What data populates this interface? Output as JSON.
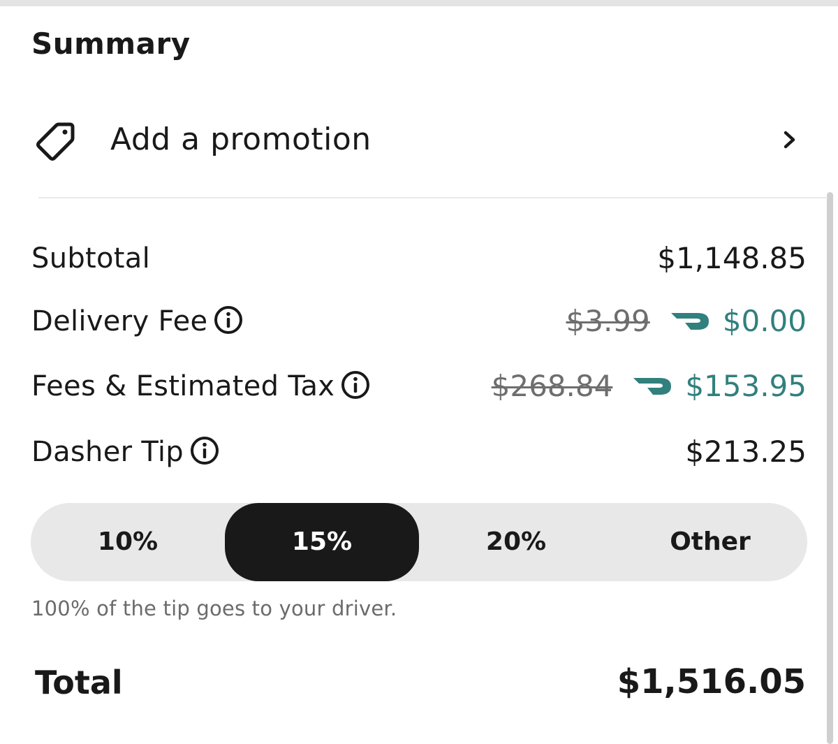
{
  "summary": {
    "title": "Summary"
  },
  "promotion": {
    "label": "Add a promotion",
    "icon": "tag-icon",
    "chevron_icon": "chevron-right-icon"
  },
  "lines": {
    "subtotal": {
      "label": "Subtotal",
      "value": "$1,148.85"
    },
    "delivery_fee": {
      "label": "Delivery Fee",
      "original": "$3.99",
      "value": "$0.00",
      "icon": "dashpass-icon"
    },
    "fees_tax": {
      "label": "Fees & Estimated Tax",
      "original": "$268.84",
      "value": "$153.95",
      "icon": "dashpass-icon"
    },
    "dasher_tip": {
      "label": "Dasher Tip",
      "value": "$213.25"
    }
  },
  "tip_options": {
    "options": [
      "10%",
      "15%",
      "20%",
      "Other"
    ],
    "selected": "15%",
    "note": "100% of the tip goes to your driver."
  },
  "total": {
    "label": "Total",
    "value": "$1,516.05"
  },
  "colors": {
    "accent_teal": "#31807d",
    "selected_bg": "#191919",
    "segment_bg": "#e8e8e8",
    "text": "#191919",
    "muted": "#6b6b6b"
  }
}
